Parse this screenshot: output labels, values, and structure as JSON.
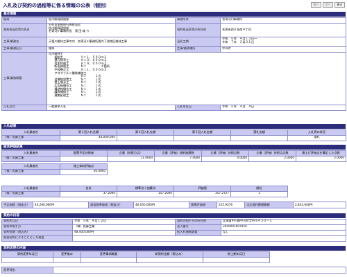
{
  "header": {
    "title": "入札及び契約の過程等に係る情報の公表（個別）",
    "nav": [
      "前へ",
      "次へ",
      "戻る"
    ]
  },
  "basic": {
    "section_title": "基本情報",
    "bureau_label": "部局",
    "bureau_value": "旭川開発建設部",
    "dept_label": "事務所等",
    "dept_value": "名寄河川事務所",
    "officer_label": "契約担当官等の氏名",
    "officer_lines": [
      "分任支出負担行為担当官",
      "旭川開発建設部",
      "名寄河川事務所長　濱 田 雄 介"
    ],
    "office_addr_label": "契約担当官等の所在地",
    "office_addr_value": "名寄市西６条南９丁目",
    "work_name_label": "工事/業務名",
    "work_name_value": "天塩川維持工事の内　名寄河川事務所管内下流地区維持工事",
    "period_label": "当初工期",
    "period_lines": [
      "令和　６年　４月１３日～",
      "令和　７年　３月３１日"
    ],
    "category_label": "工事/業務区分",
    "category_value": "維持",
    "place_label": "工事/業務場所",
    "place_value": "中川町",
    "summary_label": "工事/業務概要",
    "summary_lines": [
      "河川維持工",
      "　　掘削工　　　　　　Ｖ＝１，５００ｍ３",
      "　　還元除草工　　　　Ａ＝３，８００ｍ２",
      "　　伐木除根工　　　　Ａ＝９，０００ｍ２",
      "　　断面修復工　　　　Ｎ＝　　　　　４箇所",
      "　　不陸整正工　　　　Ａ＝１，０００ｍ２",
      "　　アスファルト舗装補修工",
      "　　　　　　　　　　　Ｎ＝　　　１式",
      "　　付属物設置工　　　Ｎ＝　　　１式",
      "　　置土撤去工　　　　Ｎ＝　　　１式",
      "　　広告板撤去工　　　Ｎ＝　　　１式",
      "　　構造物撤去工　　　Ｎ＝　　　１式",
      "　　護岸補修工　　　　Ｎ＝　　　１式",
      "　　運搬処理工　　　　Ｎ＝　　　１式"
    ],
    "bid_method_label": "入札方式",
    "bid_method_value": "一般競争入札",
    "bid_date_label": "入札年月日",
    "bid_date_value": "令和　６年　４月　４日"
  },
  "bid_results": {
    "section_title": "入札結果",
    "headers": [
      "入札業者名",
      "第１回入札金額",
      "第２回入札金額",
      "第３回入札金額",
      "落札金額",
      "入札等の状況"
    ],
    "rows": [
      {
        "name": "（株）佐藤工業",
        "r1": "44,000,000",
        "r2": "",
        "r3": "",
        "award": "",
        "status": "落札"
      }
    ]
  },
  "eval": {
    "section_title": "総合評価結果",
    "h1": [
      "入札業者名",
      "配置予定技術者",
      "企業（技術力点）",
      "企業（評価）技術施適数",
      "企業（評価）技術点数",
      "企業（評価）技術点点数",
      "最上げ評価点を算定した点数"
    ],
    "r1": [
      "（株）佐藤工業",
      "",
      "11.0000",
      "7.4000",
      "4.0000",
      "2.0000",
      "2.0000"
    ],
    "h2": [
      "入札業者名",
      "施工体制評価点"
    ],
    "r2": [
      "（株）佐藤工業",
      "30.0000"
    ],
    "h3": [
      "入札業者名",
      "合計",
      "標準点＋加算点",
      "評価値",
      "順位"
    ],
    "r3": [
      "（株）佐藤工業",
      "37.2000",
      "157.2000",
      "357.2727",
      "1"
    ]
  },
  "prices": {
    "estimate_label": "予定価格（税抜き）",
    "estimate_value": "44,260,000円",
    "survey_label": "調査基準価格（税抜き）",
    "survey_value": "40,050,000円",
    "ratio_label": "基準評価値",
    "ratio_value": "225.9376",
    "min_label": "法定福利費模算額",
    "min_value": "2,832,640円"
  },
  "contract": {
    "section_title": "契約の内容",
    "date_label": "契約年月日",
    "date_value": "令和　６年　４月１２日",
    "addr_label": "契約の相手方の所在地",
    "addr_value": "北海道中川郡中川町字中川４３０－５",
    "party_label": "契約の相手方",
    "party_value": "（株）佐藤工業",
    "corp_label": "法人番号",
    "corp_value": "3450001007450",
    "amount_label": "契約金額（税込み）",
    "amount_value": "48,400,000円",
    "low_label": "低入札価格調査",
    "low_value": "なし",
    "reason_label": "随意契約によることとした理由",
    "reason_value": ""
  },
  "changes": {
    "section_title": "契約変更の内容",
    "headers": [
      "契約変更年月日",
      "変更後の",
      "変更事項概要",
      "新契約金額（税込み）",
      "新工期年月日"
    ],
    "reason_label": "変更理由",
    "reason_value": ""
  }
}
